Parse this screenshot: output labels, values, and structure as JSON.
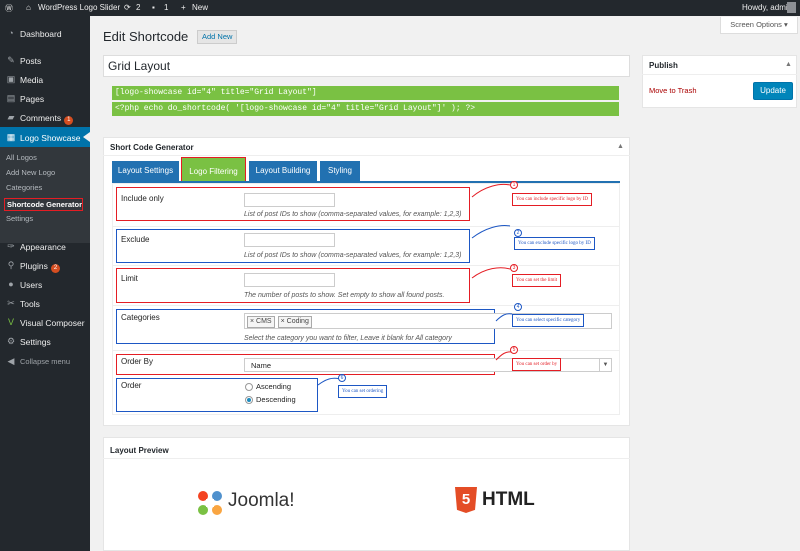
{
  "adminbar": {
    "site_name": "WordPress Logo Slider",
    "updates": "2",
    "comments": "1",
    "new_label": "New",
    "howdy": "Howdy, admin"
  },
  "screen_options": "Screen Options",
  "menu": {
    "dashboard": "Dashboard",
    "posts": "Posts",
    "media": "Media",
    "pages": "Pages",
    "comments": "Comments",
    "comments_badge": "1",
    "logo_showcase": "Logo Showcase",
    "sub": {
      "all_logos": "All Logos",
      "add_new_logo": "Add New Logo",
      "categories": "Categories",
      "shortcode_generator": "Shortcode Generator",
      "settings": "Settings"
    },
    "appearance": "Appearance",
    "plugins": "Plugins",
    "plugins_badge": "2",
    "users": "Users",
    "tools": "Tools",
    "visual_composer": "Visual Composer",
    "settings": "Settings",
    "collapse": "Collapse menu"
  },
  "page": {
    "title": "Edit Shortcode",
    "add_new": "Add New",
    "post_title": "Grid Layout"
  },
  "shortcode": {
    "line1": "[logo-showcase id=\"4\" title=\"Grid Layout\"]",
    "line2": "<?php echo do_shortcode( '[logo-showcase id=\"4\" title=\"Grid Layout\"]' ); ?>"
  },
  "generator": {
    "title": "Short Code Generator",
    "tabs": [
      "Layout Settings",
      "Logo Filtering",
      "Layout Building",
      "Styling"
    ],
    "fields": {
      "include_label": "Include only",
      "include_desc": "List of post IDs to show (comma-separated values, for example: 1,2,3)",
      "exclude_label": "Exclude",
      "exclude_desc": "List of post IDs to show (comma-separated values, for example: 1,2,3)",
      "limit_label": "Limit",
      "limit_desc": "The number of posts to show. Set empty to show all found posts.",
      "categories_label": "Categories",
      "cat1": "CMS",
      "cat2": "Coding",
      "categories_desc": "Select the category you want to filter, Leave it blank for All category",
      "orderby_label": "Order By",
      "orderby_value": "Name",
      "order_label": "Order",
      "order_asc": "Ascending",
      "order_desc": "Descending"
    },
    "annotations": {
      "n1": "1",
      "a1": "You can include specific logo by ID",
      "n2": "2",
      "a2": "You can exclude specific logo by ID",
      "n3": "3",
      "a3": "You can set the limit",
      "n4": "4",
      "a4": "You can select specific category",
      "n5": "5",
      "a5": "You can set order by",
      "n6": "6",
      "a6": "You can set ordering"
    }
  },
  "preview": {
    "title": "Layout Preview",
    "logo1": "Joomla!",
    "logo2": "HTML",
    "html5_digit": "5"
  },
  "publish": {
    "title": "Publish",
    "trash": "Move to Trash",
    "update": "Update"
  },
  "colors": {
    "accent": "#2271b1",
    "green_code": "#7ac143",
    "annotation_red": "#e41d24",
    "annotation_blue": "#1d57c4"
  }
}
